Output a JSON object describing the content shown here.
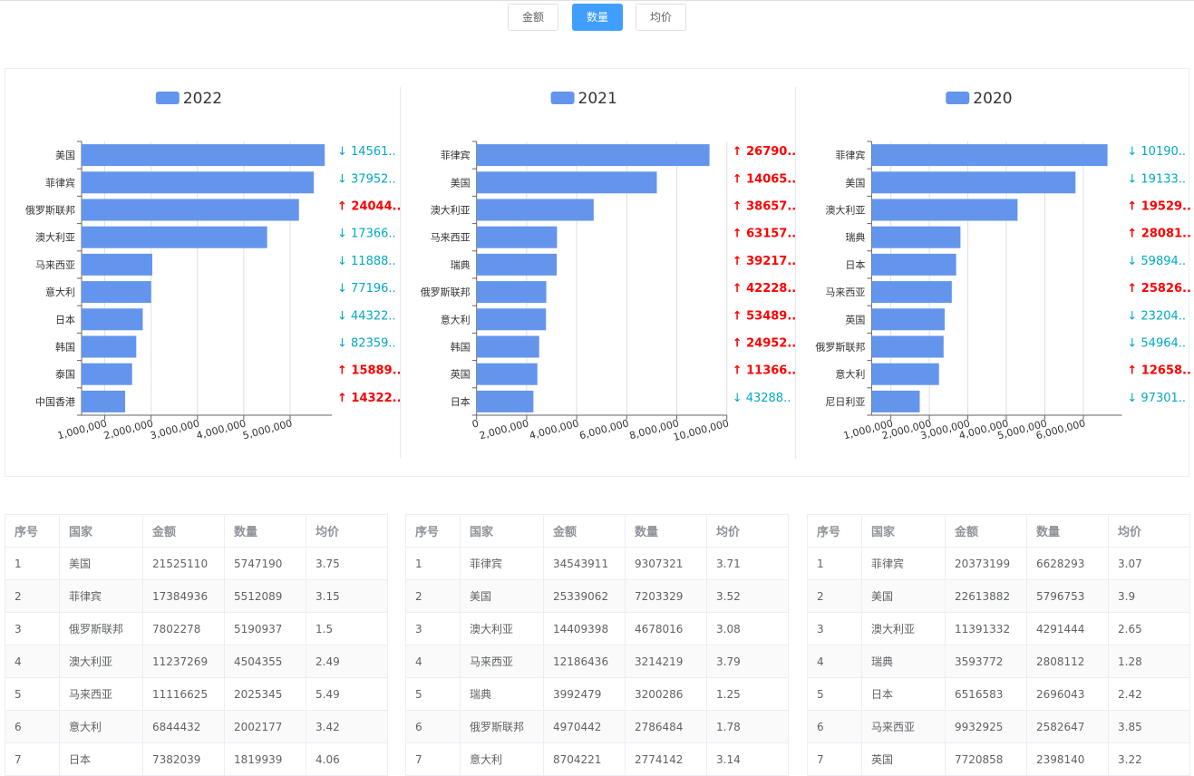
{
  "toolbar": {
    "buttons": [
      {
        "label": "金额",
        "active": false
      },
      {
        "label": "数量",
        "active": true
      },
      {
        "label": "均价",
        "active": false
      }
    ]
  },
  "colors": {
    "bar": "#6495ED",
    "up": "#FF0000",
    "down": "#00A9C4",
    "active": "#409EFF"
  },
  "chart_data": [
    {
      "type": "bar",
      "orientation": "horizontal",
      "legend": "2022",
      "categories": [
        "美国",
        "菲律宾",
        "俄罗斯联邦",
        "澳大利亚",
        "马来西亚",
        "意大利",
        "日本",
        "韩国",
        "泰国",
        "中国香港"
      ],
      "values": [
        5747190,
        5512089,
        5190937,
        4504355,
        2025345,
        2002177,
        1819939,
        1680000,
        1590000,
        1440000
      ],
      "xlim": [
        500000,
        5900000
      ],
      "xticks": [
        1000000,
        2000000,
        3000000,
        4000000,
        5000000
      ],
      "xtick_labels": [
        "1,000,000",
        "2,000,000",
        "3,000,000",
        "4,000,000",
        "5,000,000"
      ],
      "change_labels": [
        {
          "text": "↓ 14561..",
          "dir": "down"
        },
        {
          "text": "↓ 37952..",
          "dir": "down"
        },
        {
          "text": "↑ 24044..",
          "dir": "up"
        },
        {
          "text": "↓ 17366..",
          "dir": "down"
        },
        {
          "text": "↓ 11888..",
          "dir": "down"
        },
        {
          "text": "↓ 77196..",
          "dir": "down"
        },
        {
          "text": "↓ 44322..",
          "dir": "down"
        },
        {
          "text": "↓ 82359..",
          "dir": "down"
        },
        {
          "text": "↑ 15889..",
          "dir": "up"
        },
        {
          "text": "↑ 14322..",
          "dir": "up"
        }
      ]
    },
    {
      "type": "bar",
      "orientation": "horizontal",
      "legend": "2021",
      "categories": [
        "菲律宾",
        "美国",
        "澳大利亚",
        "马来西亚",
        "瑞典",
        "俄罗斯联邦",
        "意大利",
        "韩国",
        "英国",
        "日本"
      ],
      "values": [
        9307321,
        7203329,
        4678016,
        3214219,
        3200286,
        2786484,
        2774142,
        2500000,
        2430000,
        2270000
      ],
      "xlim": [
        0,
        10000000
      ],
      "xticks": [
        0,
        2000000,
        4000000,
        6000000,
        8000000,
        10000000
      ],
      "xtick_labels": [
        "0",
        "2,000,000",
        "4,000,000",
        "6,000,000",
        "8,000,000",
        "10,000,000"
      ],
      "change_labels": [
        {
          "text": "↑ 26790..",
          "dir": "up"
        },
        {
          "text": "↑ 14065..",
          "dir": "up"
        },
        {
          "text": "↑ 38657..",
          "dir": "up"
        },
        {
          "text": "↑ 63157..",
          "dir": "up"
        },
        {
          "text": "↑ 39217..",
          "dir": "up"
        },
        {
          "text": "↑ 42228..",
          "dir": "up"
        },
        {
          "text": "↑ 53489..",
          "dir": "up"
        },
        {
          "text": "↑ 24952..",
          "dir": "up"
        },
        {
          "text": "↑ 11366..",
          "dir": "up"
        },
        {
          "text": "↓ 43288..",
          "dir": "down"
        }
      ]
    },
    {
      "type": "bar",
      "orientation": "horizontal",
      "legend": "2020",
      "categories": [
        "菲律宾",
        "美国",
        "澳大利亚",
        "瑞典",
        "日本",
        "马来西亚",
        "英国",
        "俄罗斯联邦",
        "意大利",
        "尼日利亚"
      ],
      "values": [
        6628293,
        5796753,
        4291444,
        2808112,
        2696043,
        2582647,
        2398140,
        2370000,
        2250000,
        1750000
      ],
      "xlim": [
        500000,
        7000000
      ],
      "xticks": [
        1000000,
        2000000,
        3000000,
        4000000,
        5000000,
        6000000
      ],
      "xtick_labels": [
        "1,000,000",
        "2,000,000",
        "3,000,000",
        "4,000,000",
        "5,000,000",
        "6,000,000"
      ],
      "change_labels": [
        {
          "text": "↓ 10190..",
          "dir": "down"
        },
        {
          "text": "↓ 19133..",
          "dir": "down"
        },
        {
          "text": "↑ 19529..",
          "dir": "up"
        },
        {
          "text": "↑ 28081..",
          "dir": "up"
        },
        {
          "text": "↓ 59894..",
          "dir": "down"
        },
        {
          "text": "↑ 25826..",
          "dir": "up"
        },
        {
          "text": "↓ 23204..",
          "dir": "down"
        },
        {
          "text": "↓ 54964..",
          "dir": "down"
        },
        {
          "text": "↑ 12658..",
          "dir": "up"
        },
        {
          "text": "↓ 97301..",
          "dir": "down"
        }
      ]
    }
  ],
  "tables": [
    {
      "headers": [
        "序号",
        "国家",
        "金额",
        "数量",
        "均价"
      ],
      "rows": [
        [
          "1",
          "美国",
          "21525110",
          "5747190",
          "3.75"
        ],
        [
          "2",
          "菲律宾",
          "17384936",
          "5512089",
          "3.15"
        ],
        [
          "3",
          "俄罗斯联邦",
          "7802278",
          "5190937",
          "1.5"
        ],
        [
          "4",
          "澳大利亚",
          "11237269",
          "4504355",
          "2.49"
        ],
        [
          "5",
          "马来西亚",
          "11116625",
          "2025345",
          "5.49"
        ],
        [
          "6",
          "意大利",
          "6844432",
          "2002177",
          "3.42"
        ],
        [
          "7",
          "日本",
          "7382039",
          "1819939",
          "4.06"
        ]
      ]
    },
    {
      "headers": [
        "序号",
        "国家",
        "金额",
        "数量",
        "均价"
      ],
      "rows": [
        [
          "1",
          "菲律宾",
          "34543911",
          "9307321",
          "3.71"
        ],
        [
          "2",
          "美国",
          "25339062",
          "7203329",
          "3.52"
        ],
        [
          "3",
          "澳大利亚",
          "14409398",
          "4678016",
          "3.08"
        ],
        [
          "4",
          "马来西亚",
          "12186436",
          "3214219",
          "3.79"
        ],
        [
          "5",
          "瑞典",
          "3992479",
          "3200286",
          "1.25"
        ],
        [
          "6",
          "俄罗斯联邦",
          "4970442",
          "2786484",
          "1.78"
        ],
        [
          "7",
          "意大利",
          "8704221",
          "2774142",
          "3.14"
        ]
      ]
    },
    {
      "headers": [
        "序号",
        "国家",
        "金额",
        "数量",
        "均价"
      ],
      "rows": [
        [
          "1",
          "菲律宾",
          "20373199",
          "6628293",
          "3.07"
        ],
        [
          "2",
          "美国",
          "22613882",
          "5796753",
          "3.9"
        ],
        [
          "3",
          "澳大利亚",
          "11391332",
          "4291444",
          "2.65"
        ],
        [
          "4",
          "瑞典",
          "3593772",
          "2808112",
          "1.28"
        ],
        [
          "5",
          "日本",
          "6516583",
          "2696043",
          "2.42"
        ],
        [
          "6",
          "马来西亚",
          "9932925",
          "2582647",
          "3.85"
        ],
        [
          "7",
          "英国",
          "7720858",
          "2398140",
          "3.22"
        ]
      ]
    }
  ]
}
